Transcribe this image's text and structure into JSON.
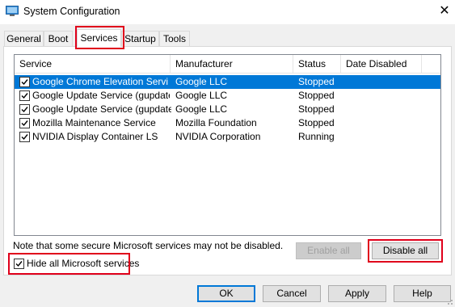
{
  "window": {
    "title": "System Configuration",
    "close_glyph": "✕"
  },
  "tabs": [
    {
      "label": "General"
    },
    {
      "label": "Boot"
    },
    {
      "label": "Services"
    },
    {
      "label": "Startup"
    },
    {
      "label": "Tools"
    }
  ],
  "services": {
    "columns": [
      "Service",
      "Manufacturer",
      "Status",
      "Date Disabled"
    ],
    "rows": [
      {
        "service": "Google Chrome Elevation Servic...",
        "manufacturer": "Google LLC",
        "status": "Stopped",
        "date_disabled": "",
        "checked": true,
        "selected": true
      },
      {
        "service": "Google Update Service (gupdate)",
        "manufacturer": "Google LLC",
        "status": "Stopped",
        "date_disabled": "",
        "checked": true,
        "selected": false
      },
      {
        "service": "Google Update Service (gupdatem)",
        "manufacturer": "Google LLC",
        "status": "Stopped",
        "date_disabled": "",
        "checked": true,
        "selected": false
      },
      {
        "service": "Mozilla Maintenance Service",
        "manufacturer": "Mozilla Foundation",
        "status": "Stopped",
        "date_disabled": "",
        "checked": true,
        "selected": false
      },
      {
        "service": "NVIDIA Display Container LS",
        "manufacturer": "NVIDIA Corporation",
        "status": "Running",
        "date_disabled": "",
        "checked": true,
        "selected": false
      }
    ]
  },
  "note": "Note that some secure Microsoft services may not be disabled.",
  "enable_all": "Enable all",
  "disable_all": "Disable all",
  "hide_ms": {
    "label": "Hide all Microsoft services",
    "checked": true
  },
  "footer": {
    "ok": "OK",
    "cancel": "Cancel",
    "apply": "Apply",
    "help": "Help"
  },
  "colors": {
    "highlight": "#e0001b",
    "selection": "#0078d7"
  }
}
